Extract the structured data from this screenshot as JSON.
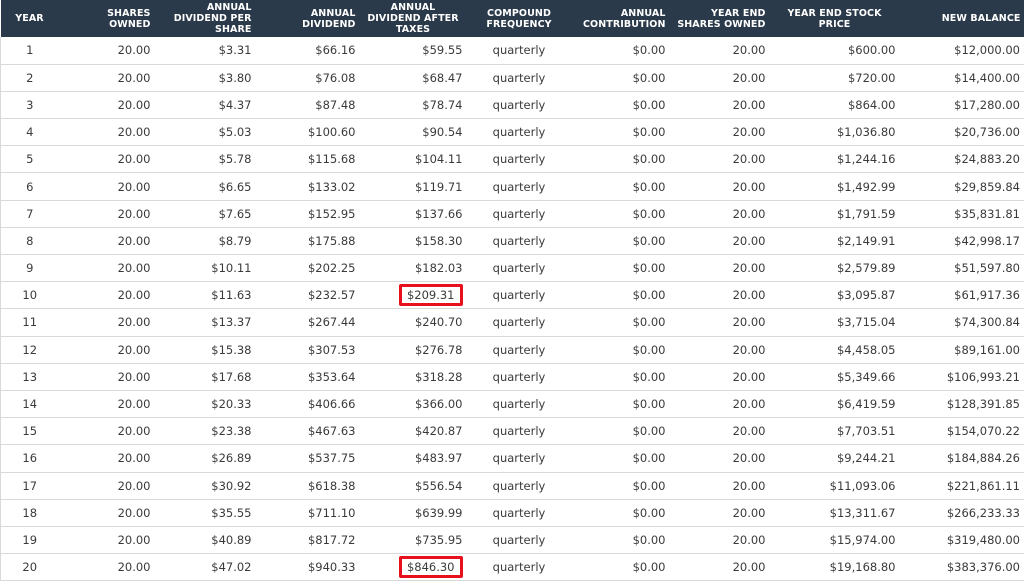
{
  "colors": {
    "header_bg": "#2b3a4a",
    "highlight": "#e8101c"
  },
  "header": {
    "year": "YEAR",
    "shares_owned": "SHARES OWNED",
    "div_per_share": "ANNUAL DIVIDEND PER SHARE",
    "annual_dividend": "ANNUAL DIVIDEND",
    "after_taxes": "ANNUAL DIVIDEND AFTER TAXES",
    "compound_freq": "COMPOUND FREQUENCY",
    "contribution": "ANNUAL CONTRIBUTION",
    "ye_shares": "YEAR END SHARES OWNED",
    "ye_price": "YEAR END STOCK PRICE",
    "new_balance": "NEW BALANCE"
  },
  "rows": [
    [
      "1",
      "20.00",
      "$3.31",
      "$66.16",
      "$59.55",
      "quarterly",
      "$0.00",
      "20.00",
      "$600.00",
      "$12,000.00"
    ],
    [
      "2",
      "20.00",
      "$3.80",
      "$76.08",
      "$68.47",
      "quarterly",
      "$0.00",
      "20.00",
      "$720.00",
      "$14,400.00"
    ],
    [
      "3",
      "20.00",
      "$4.37",
      "$87.48",
      "$78.74",
      "quarterly",
      "$0.00",
      "20.00",
      "$864.00",
      "$17,280.00"
    ],
    [
      "4",
      "20.00",
      "$5.03",
      "$100.60",
      "$90.54",
      "quarterly",
      "$0.00",
      "20.00",
      "$1,036.80",
      "$20,736.00"
    ],
    [
      "5",
      "20.00",
      "$5.78",
      "$115.68",
      "$104.11",
      "quarterly",
      "$0.00",
      "20.00",
      "$1,244.16",
      "$24,883.20"
    ],
    [
      "6",
      "20.00",
      "$6.65",
      "$133.02",
      "$119.71",
      "quarterly",
      "$0.00",
      "20.00",
      "$1,492.99",
      "$29,859.84"
    ],
    [
      "7",
      "20.00",
      "$7.65",
      "$152.95",
      "$137.66",
      "quarterly",
      "$0.00",
      "20.00",
      "$1,791.59",
      "$35,831.81"
    ],
    [
      "8",
      "20.00",
      "$8.79",
      "$175.88",
      "$158.30",
      "quarterly",
      "$0.00",
      "20.00",
      "$2,149.91",
      "$42,998.17"
    ],
    [
      "9",
      "20.00",
      "$10.11",
      "$202.25",
      "$182.03",
      "quarterly",
      "$0.00",
      "20.00",
      "$2,579.89",
      "$51,597.80"
    ],
    [
      "10",
      "20.00",
      "$11.63",
      "$232.57",
      "$209.31",
      "quarterly",
      "$0.00",
      "20.00",
      "$3,095.87",
      "$61,917.36"
    ],
    [
      "11",
      "20.00",
      "$13.37",
      "$267.44",
      "$240.70",
      "quarterly",
      "$0.00",
      "20.00",
      "$3,715.04",
      "$74,300.84"
    ],
    [
      "12",
      "20.00",
      "$15.38",
      "$307.53",
      "$276.78",
      "quarterly",
      "$0.00",
      "20.00",
      "$4,458.05",
      "$89,161.00"
    ],
    [
      "13",
      "20.00",
      "$17.68",
      "$353.64",
      "$318.28",
      "quarterly",
      "$0.00",
      "20.00",
      "$5,349.66",
      "$106,993.21"
    ],
    [
      "14",
      "20.00",
      "$20.33",
      "$406.66",
      "$366.00",
      "quarterly",
      "$0.00",
      "20.00",
      "$6,419.59",
      "$128,391.85"
    ],
    [
      "15",
      "20.00",
      "$23.38",
      "$467.63",
      "$420.87",
      "quarterly",
      "$0.00",
      "20.00",
      "$7,703.51",
      "$154,070.22"
    ],
    [
      "16",
      "20.00",
      "$26.89",
      "$537.75",
      "$483.97",
      "quarterly",
      "$0.00",
      "20.00",
      "$9,244.21",
      "$184,884.26"
    ],
    [
      "17",
      "20.00",
      "$30.92",
      "$618.38",
      "$556.54",
      "quarterly",
      "$0.00",
      "20.00",
      "$11,093.06",
      "$221,861.11"
    ],
    [
      "18",
      "20.00",
      "$35.55",
      "$711.10",
      "$639.99",
      "quarterly",
      "$0.00",
      "20.00",
      "$13,311.67",
      "$266,233.33"
    ],
    [
      "19",
      "20.00",
      "$40.89",
      "$817.72",
      "$735.95",
      "quarterly",
      "$0.00",
      "20.00",
      "$15,974.00",
      "$319,480.00"
    ],
    [
      "20",
      "20.00",
      "$47.02",
      "$940.33",
      "$846.30",
      "quarterly",
      "$0.00",
      "20.00",
      "$19,168.80",
      "$383,376.00"
    ]
  ],
  "highlighted": [
    {
      "row": 10,
      "column": "after_taxes",
      "value": "$209.31"
    },
    {
      "row": 20,
      "column": "after_taxes",
      "value": "$846.30"
    }
  ]
}
